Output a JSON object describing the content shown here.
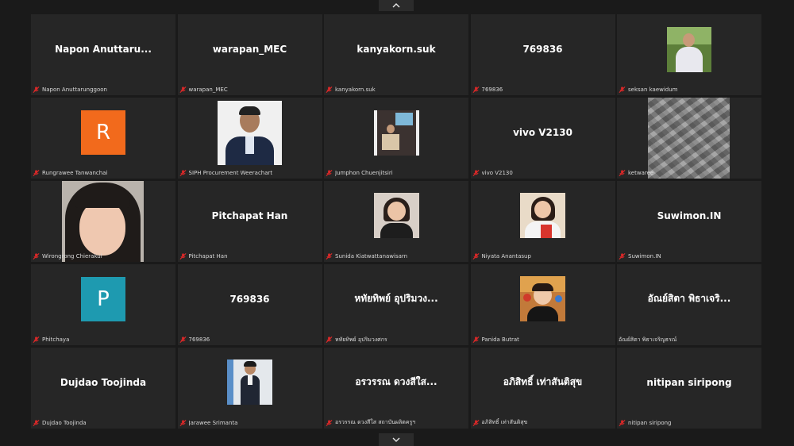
{
  "tiles": [
    {
      "display": "Napon  Anuttaru...",
      "caption": "Napon Anuttarunggoon",
      "muted": true
    },
    {
      "display": "warapan_MEC",
      "caption": "warapan_MEC",
      "muted": true
    },
    {
      "display": "kanyakorn.suk",
      "caption": "kanyakorn.suk",
      "muted": true
    },
    {
      "display": "769836",
      "caption": "769836",
      "muted": true
    },
    {
      "caption": "seksan kaewidum",
      "muted": true
    },
    {
      "letter": "R",
      "letter_color": "#f26a1c",
      "caption": "Rungrawee Tanwanchai",
      "muted": true
    },
    {
      "caption": "SIPH Procurement Weerachart",
      "muted": true
    },
    {
      "caption": "Jumphon Chuenjitsiri",
      "muted": true
    },
    {
      "display": "vivo V2130",
      "caption": "vivo V2130",
      "muted": true
    },
    {
      "caption": "ketwaree",
      "muted": true
    },
    {
      "caption": "Wirongrong Chierakul",
      "muted": true
    },
    {
      "display": "Pitchapat Han",
      "caption": "Pitchapat Han",
      "muted": true
    },
    {
      "caption": "Sunida Kiatwattanawisarn",
      "muted": true
    },
    {
      "caption": "Niyata Anantasup",
      "muted": true
    },
    {
      "display": "Suwimon.IN",
      "caption": "Suwimon.IN",
      "muted": true
    },
    {
      "letter": "P",
      "letter_color": "#1e9ab0",
      "caption": "Phitchaya",
      "muted": true
    },
    {
      "display": "769836",
      "caption": "769836",
      "muted": true
    },
    {
      "display": "หทัยทิพย์ อุปริมวง...",
      "caption": "หทัยทิพย์ อุปริมวงศกร",
      "muted": true
    },
    {
      "caption": "Panida Butrat",
      "muted": true
    },
    {
      "display": "อัณย์สิตา พิธาเจริ...",
      "caption": "อัณย์สิตา พิธาเจริญธรณ์",
      "muted": false
    },
    {
      "display": "Dujdao Toojinda",
      "caption": "Dujdao Toojinda",
      "muted": true
    },
    {
      "caption": "Jarawee Srimanta",
      "muted": true
    },
    {
      "display": "อรวรรณ ดวงสีใส...",
      "caption": "อรวรรณ ดวงสีใส สถาบันผลิตครูฯ",
      "muted": true
    },
    {
      "display": "อภิสิทธิ์ เท่าสันติสุข",
      "caption": "อภิสิทธิ์ เท่าสันติสุข",
      "muted": true
    },
    {
      "display": "nitipan siripong",
      "caption": "nitipan siripong",
      "muted": true
    }
  ],
  "icons": {
    "nav_up": "chevron-up-icon",
    "nav_down": "chevron-down-icon",
    "muted_mic": "muted-mic-icon"
  },
  "colors": {
    "background": "#1a1a1a",
    "tile": "#262626",
    "muted_mic": "#e02828"
  }
}
